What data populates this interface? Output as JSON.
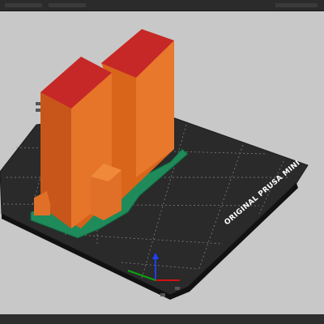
{
  "app": {
    "name": "PrusaSlicer 3D view"
  },
  "bed": {
    "label": "ORIGINAL PRUSA MINI",
    "surface_color": "#2b2b2b",
    "grid_color": "#8a8a8a"
  },
  "model": {
    "body_color": "#e06b1f",
    "top_color": "#c62828",
    "brim_color": "#1f8a5a"
  },
  "axes": {
    "z_color": "#1e40ff",
    "x_color": "#d01010",
    "y_color": "#10a010"
  }
}
